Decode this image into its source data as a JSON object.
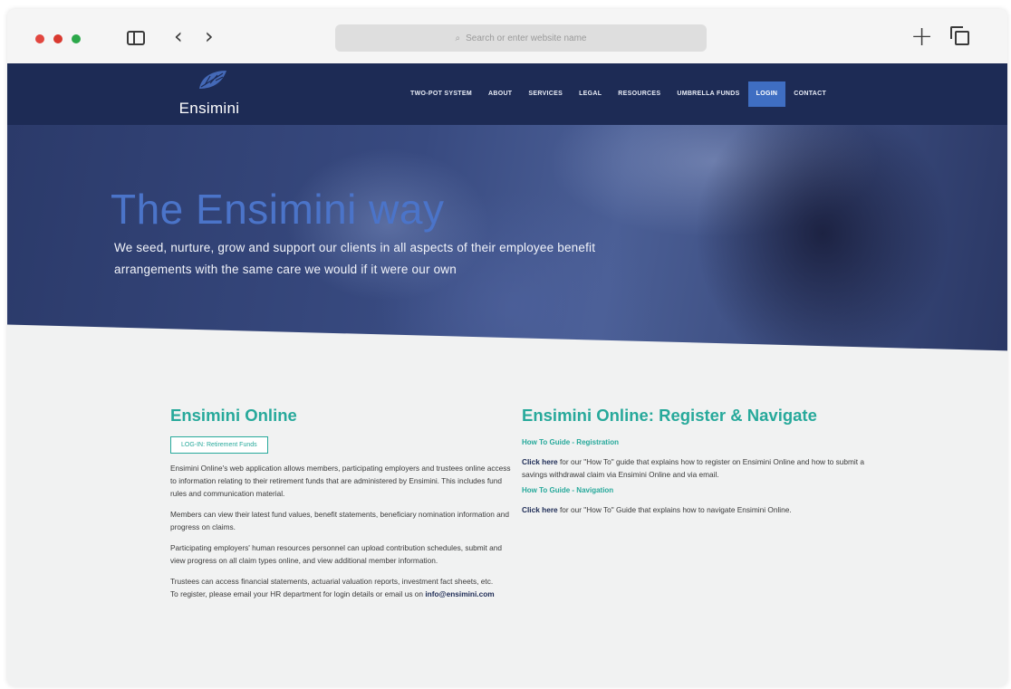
{
  "browser": {
    "search_placeholder": "Search or enter website name"
  },
  "site": {
    "logo_text": "Ensimini",
    "nav": [
      {
        "label": "TWO-POT SYSTEM"
      },
      {
        "label": "ABOUT"
      },
      {
        "label": "SERVICES"
      },
      {
        "label": "LEGAL"
      },
      {
        "label": "RESOURCES"
      },
      {
        "label": "UMBRELLA FUNDS"
      },
      {
        "label": "LOGIN"
      },
      {
        "label": "CONTACT"
      }
    ]
  },
  "hero": {
    "title": "The Ensimini way",
    "subtitle": "We seed, nurture, grow and support our clients in all aspects of their employee benefit arrangements with the same care we would if it were our own"
  },
  "left": {
    "heading": "Ensimini Online",
    "login_button": "LOG-IN: Retirement Funds",
    "p1": "Ensimini Online's web application allows members, participating employers and trustees online access to information relating to their retirement funds that are administered by Ensimini. This includes fund rules and communication material.",
    "p2": "Members can view their latest fund values, benefit statements, beneficiary nomination information and progress on claims.",
    "p3": "Participating employers' human resources personnel can upload contribution schedules, submit and view progress on all claim types online, and view additional member information.",
    "p4": "Trustees can access financial statements, actuarial valuation reports, investment fact sheets, etc.",
    "p5_prefix": "To register, please email your HR department for login details or email us on",
    "email": "info@ensimini.com"
  },
  "right": {
    "heading": "Ensimini Online: Register & Navigate",
    "guide1_title": "How To Guide - Registration",
    "guide1_click": "Click here",
    "guide1_text": "for our \"How To\" guide that explains how to register on Ensimini Online and how to submit a savings withdrawal claim via Ensimini Online and via email.",
    "guide2_title": "How To Guide - Navigation",
    "guide2_click": "Click here",
    "guide2_text": "for our \"How To\" Guide that explains how to navigate Ensimini Online."
  },
  "colors": {
    "nav_bg": "#1d2b55",
    "accent_teal": "#27a99b",
    "active_nav": "#3f6ec2",
    "hero_title": "#4b74c9"
  }
}
